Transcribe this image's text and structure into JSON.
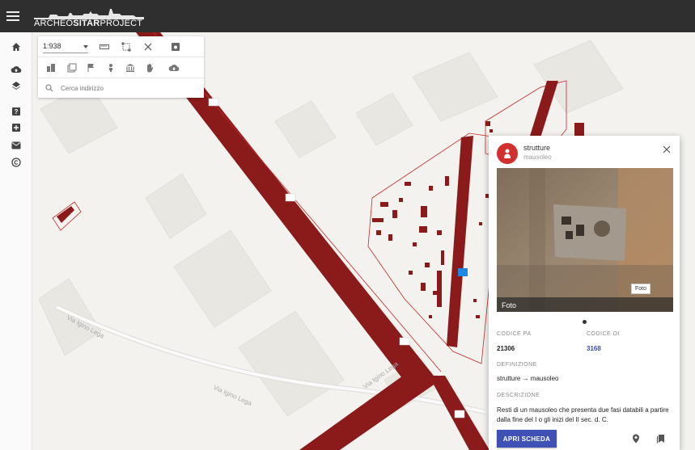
{
  "app": {
    "logo_prefix": "ARCHEO",
    "logo_bold": "SITAR",
    "logo_suffix": "PROJECT"
  },
  "toolbar": {
    "scale_value": "1:938",
    "search_placeholder": "Cerca indirizzo"
  },
  "map": {
    "street_label_1": "Via Igino Lega",
    "street_label_2": "Via Igino Lega",
    "street_label_3": "Via Igino Lega"
  },
  "popup": {
    "title": "strutture",
    "subtitle": "mausoleo",
    "photo_caption": "Foto",
    "photo_chip": "Foto",
    "codice_pa_label": "CODICE PA",
    "codice_pa_value": "21306",
    "codice_oi_label": "CODICE OI",
    "codice_oi_value": "3168",
    "definizione_label": "DEFINIZIONE",
    "definizione_value": "strutture  → mausoleo",
    "descrizione_label": "DESCRIZIONE",
    "descrizione_value": "Resti di un mausoleo che presenta due fasi databili a partire dalla fine del I o gli inizi del II sec. d. C.",
    "apri_label": "APRI SCHEDA"
  },
  "colors": {
    "topbar": "#2f2f2f",
    "road_dark_red": "#8b1a1a",
    "feature_red": "#c62828",
    "button_blue": "#3f51b5"
  }
}
